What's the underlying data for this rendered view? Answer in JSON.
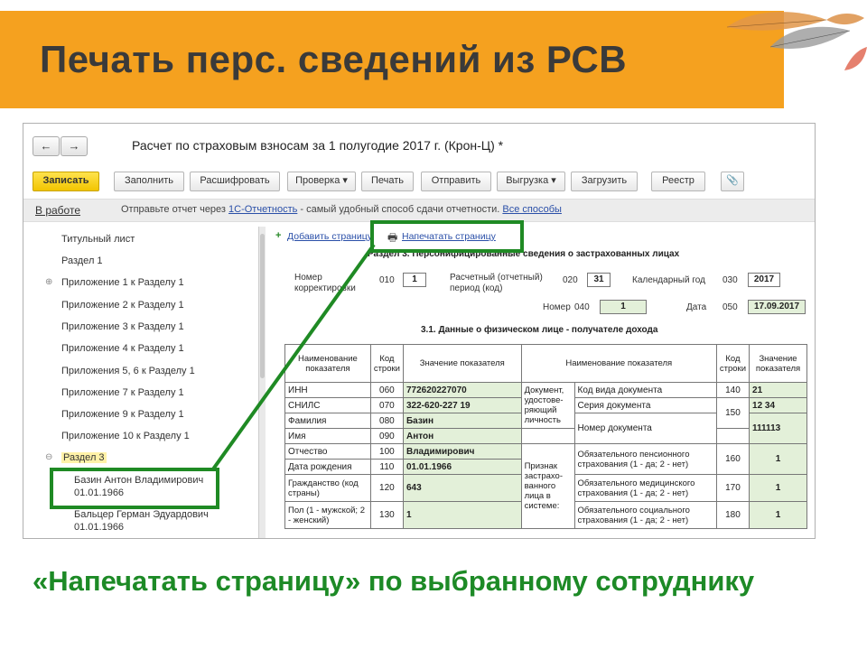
{
  "slide": {
    "title": "Печать перс. сведений из РСВ",
    "footer": "«Напечатать страницу» по выбранному сотруднику"
  },
  "window": {
    "back": "←",
    "forward": "→",
    "title": "Расчет по страховым взносам за 1 полугодие 2017 г. (Крон-Ц) *"
  },
  "toolbar": {
    "save": "Записать",
    "fill": "Заполнить",
    "decode": "Расшифровать",
    "check": "Проверка",
    "print": "Печать",
    "send": "Отправить",
    "export": "Выгрузка",
    "load": "Загрузить",
    "registry": "Реестр",
    "attach": "📎"
  },
  "status": {
    "state": "В работе",
    "text_before": "Отправьте отчет через ",
    "link": "1С-Отчетность",
    "text_after": " - самый удобный способ сдачи отчетности. ",
    "all_ways": "Все способы"
  },
  "sidebar": {
    "items": [
      "Титульный лист",
      "Раздел 1",
      "Приложение 1 к Разделу 1",
      "Приложение 2 к Разделу 1",
      "Приложение 3 к Разделу 1",
      "Приложение 4 к Разделу 1",
      "Приложения 5, 6 к Разделу 1",
      "Приложение 7 к Разделу 1",
      "Приложение 9 к Разделу 1",
      "Приложение 10 к Разделу 1",
      "Раздел 3"
    ],
    "persons": [
      {
        "name": "Базин Антон Владимирович",
        "date": "01.01.1966"
      },
      {
        "name": "Бальцер Герман Эдуардович",
        "date": "01.01.1966"
      }
    ]
  },
  "content": {
    "add_page": "Добавить страницу",
    "print_page": "Напечатать страницу",
    "section_title": "Раздел 3. Персонифицированные сведения о застрахованных лицах",
    "correction_label": "Номер корректировки",
    "code_010": "010",
    "correction_value": "1",
    "period_label": "Расчетный (отчетный) период (код)",
    "code_020": "020",
    "period_value": "31",
    "year_label": "Календарный год",
    "code_030": "030",
    "year_value": "2017",
    "number_label": "Номер",
    "code_040": "040",
    "number_value": "1",
    "date_label": "Дата",
    "code_050": "050",
    "date_value": "17.09.2017",
    "subsection_title": "3.1. Данные о физическом лице - получателе дохода"
  },
  "table": {
    "headers": {
      "name": "Наименование показателя",
      "code": "Код строки",
      "value": "Значение показателя",
      "name2": "Наименование показателя",
      "code2": "Код строки",
      "value2": "Значение показателя"
    },
    "left_rows": [
      {
        "label": "ИНН",
        "code": "060",
        "value": "772620227070"
      },
      {
        "label": "СНИЛС",
        "code": "070",
        "value": "322-620-227 19"
      },
      {
        "label": "Фамилия",
        "code": "080",
        "value": "Базин"
      },
      {
        "label": "Имя",
        "code": "090",
        "value": "Антон"
      },
      {
        "label": "Отчество",
        "code": "100",
        "value": "Владимирович"
      },
      {
        "label": "Дата рождения",
        "code": "110",
        "value": "01.01.1966"
      },
      {
        "label": "Гражданство (код страны)",
        "code": "120",
        "value": "643"
      },
      {
        "label": "Пол (1 - мужской; 2 - женский)",
        "code": "130",
        "value": "1"
      }
    ],
    "group1": "Документ, удостове-ряющий личность",
    "doc_rows": [
      {
        "label": "Код вида документа",
        "code": "140",
        "value": "21"
      },
      {
        "label": "Серия документа",
        "code": "150",
        "value": "12 34"
      },
      {
        "label": "Номер документа",
        "code": "",
        "value": "111113"
      }
    ],
    "group2": "Признак застрахо-ванного лица в системе:",
    "ins_rows": [
      {
        "label": "Обязательного пенсионного страхования (1 - да; 2 - нет)",
        "code": "160",
        "value": "1"
      },
      {
        "label": "Обязательного медицинского страхования (1 - да; 2 - нет)",
        "code": "170",
        "value": "1"
      },
      {
        "label": "Обязательного социального страхования (1 - да; 2 - нет)",
        "code": "180",
        "value": "1"
      }
    ]
  },
  "colors": {
    "banner": "#f5a11f",
    "highlight": "#1f8a24",
    "field_fill": "#e3f0d9",
    "primary_button": "#f2c500"
  }
}
